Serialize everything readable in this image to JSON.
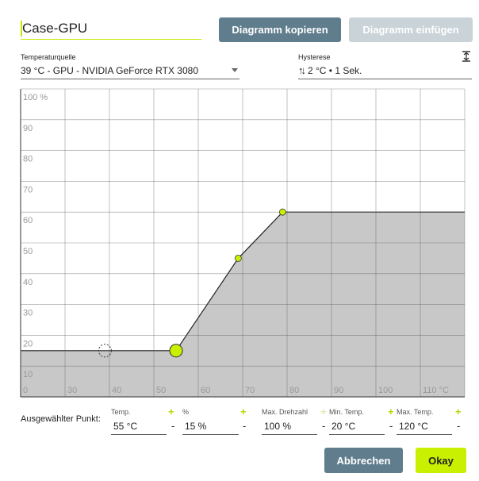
{
  "profile": {
    "name": "Case-GPU"
  },
  "toolbar": {
    "copy_label": "Diagramm kopieren",
    "paste_label": "Diagramm einfügen"
  },
  "temp_source": {
    "label": "Temperaturquelle",
    "value": "39 °C - GPU - NVIDIA GeForce RTX 3080"
  },
  "hysteresis": {
    "label": "Hysterese",
    "value": "2 °C • 1 Sek."
  },
  "chart_data": {
    "type": "area",
    "x_ticks": [
      "0",
      "30",
      "40",
      "50",
      "60",
      "70",
      "80",
      "90",
      "100",
      "110 °C"
    ],
    "y_ticks": [
      "10",
      "20",
      "30",
      "40",
      "50",
      "60",
      "70",
      "80",
      "90",
      "100 %"
    ],
    "xlim": [
      20,
      120
    ],
    "ylim": [
      0,
      100
    ],
    "grid": true,
    "points": [
      {
        "x": 20,
        "y": 15
      },
      {
        "x": 55,
        "y": 15
      },
      {
        "x": 69,
        "y": 45
      },
      {
        "x": 79,
        "y": 60
      },
      {
        "x": 120,
        "y": 60
      }
    ],
    "control_points": [
      {
        "x": 55,
        "y": 15,
        "selected": true
      },
      {
        "x": 69,
        "y": 45,
        "selected": false
      },
      {
        "x": 79,
        "y": 60,
        "selected": false
      }
    ],
    "current_temp": {
      "x": 39,
      "y": 15
    },
    "colors": {
      "fill": "#c8c8c8",
      "line": "#222222",
      "point": "#c8f000",
      "grid": "#555555"
    }
  },
  "selected_point": {
    "label": "Ausgewählter Punkt:",
    "fields": [
      {
        "label": "Temp.",
        "value": "55 °C"
      },
      {
        "label": "%",
        "value": "15 %"
      },
      {
        "label": "Max. Drehzahl",
        "value": "100 %"
      },
      {
        "label": "Min. Temp.",
        "value": "20 °C"
      },
      {
        "label": "Max. Temp.",
        "value": "120 °C"
      }
    ],
    "plus": "+",
    "minus": "-"
  },
  "footer": {
    "cancel_label": "Abbrechen",
    "ok_label": "Okay"
  }
}
